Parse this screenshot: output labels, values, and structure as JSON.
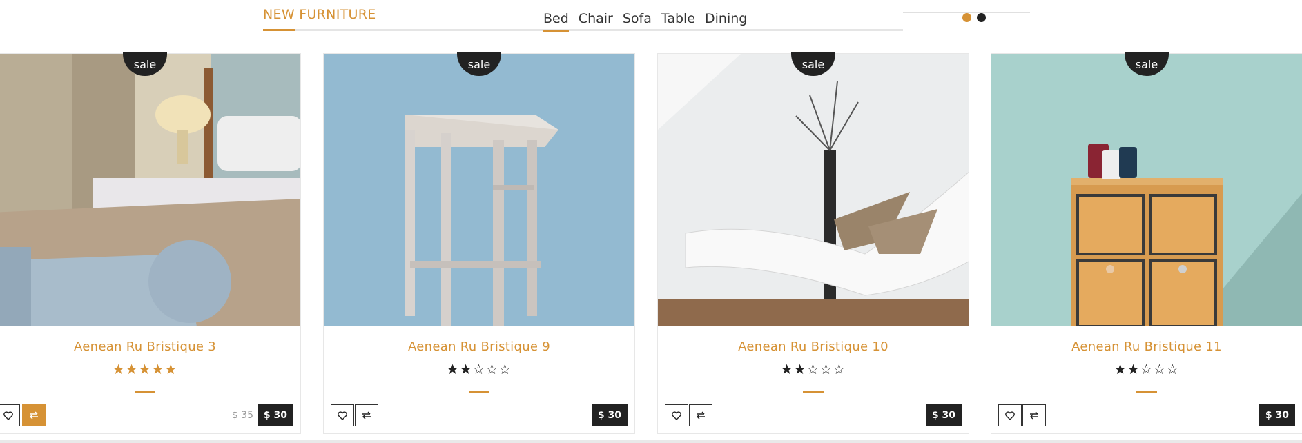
{
  "header": {
    "title": "NEW FURNITURE"
  },
  "tabs": [
    "Bed",
    "Chair",
    "Sofa",
    "Table",
    "Dining"
  ],
  "active_tab": "Bed",
  "pager": {
    "dots": 2,
    "active": 1
  },
  "products": [
    {
      "name": "Aenean Ru Bristique 3",
      "badge": "sale",
      "rating": 5,
      "old_price": "$ 35",
      "price": "$ 30",
      "image": "bedroom-image"
    },
    {
      "name": "Aenean Ru Bristique 9",
      "badge": "sale",
      "rating": 2,
      "price": "$ 30",
      "image": "stool-image"
    },
    {
      "name": "Aenean Ru Bristique 10",
      "badge": "sale",
      "rating": 2,
      "price": "$ 30",
      "image": "lounge-chair-image"
    },
    {
      "name": "Aenean Ru Bristique 11",
      "badge": "sale",
      "rating": 2,
      "price": "$ 30",
      "image": "drawer-cabinet-image"
    }
  ],
  "colors": {
    "accent": "#d69235",
    "dark": "#222222"
  }
}
